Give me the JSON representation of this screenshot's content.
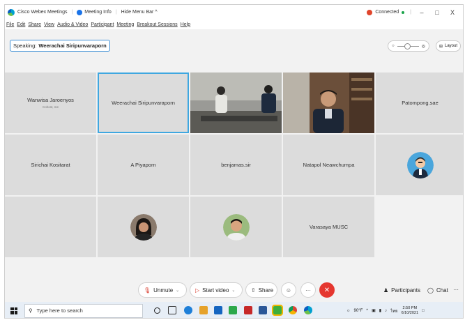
{
  "titlebar": {
    "app_title": "Cisco Webex Meetings",
    "meeting_info": "Meeting Info",
    "hide_menu": "Hide Menu Bar ^",
    "connection_status": "Connected",
    "minimize": "–",
    "restore": "□",
    "close": "X"
  },
  "menubar": {
    "items": [
      "File",
      "Edit",
      "Share",
      "View",
      "Audio & Video",
      "Participant",
      "Meeting",
      "Breakout Sessions",
      "Help"
    ]
  },
  "speaking": {
    "label": "Speaking:",
    "name": "Weerachai Siripunvaraporn"
  },
  "layout_button": {
    "label": "Layout"
  },
  "participants": [
    {
      "name": "Wanwisa Jaroenyos",
      "sub": "Cohost, me"
    },
    {
      "name": "Weerachai Siripunvaraporn",
      "active": true
    },
    {
      "name": "",
      "video": true
    },
    {
      "name": "",
      "video": true
    },
    {
      "name": "Patompong.sae"
    },
    {
      "name": "Sirichai Kositarat"
    },
    {
      "name": "A Piyaporn"
    },
    {
      "name": "benjamas.sir"
    },
    {
      "name": "Natapol Neawchumpa"
    },
    {
      "name": "",
      "avatar": "cartoon"
    },
    {
      "name": ""
    },
    {
      "name": "",
      "avatar": "woman"
    },
    {
      "name": "",
      "avatar": "man"
    },
    {
      "name": "Varasaya MUSC"
    }
  ],
  "controls": {
    "unmute": "Unmute",
    "start_video": "Start video",
    "share": "Share",
    "participants": "Participants",
    "chat": "Chat",
    "more": "···"
  },
  "taskbar": {
    "search_placeholder": "Type here to search",
    "weather": "90°F",
    "language": "ไทย",
    "time": "2:50 PM",
    "date": "6/10/2021"
  },
  "colors": {
    "accent": "#3fa7e0",
    "end_call": "#e5372f",
    "tile_bg": "#dcdcdc",
    "connected_dot": "#1aa34a"
  }
}
